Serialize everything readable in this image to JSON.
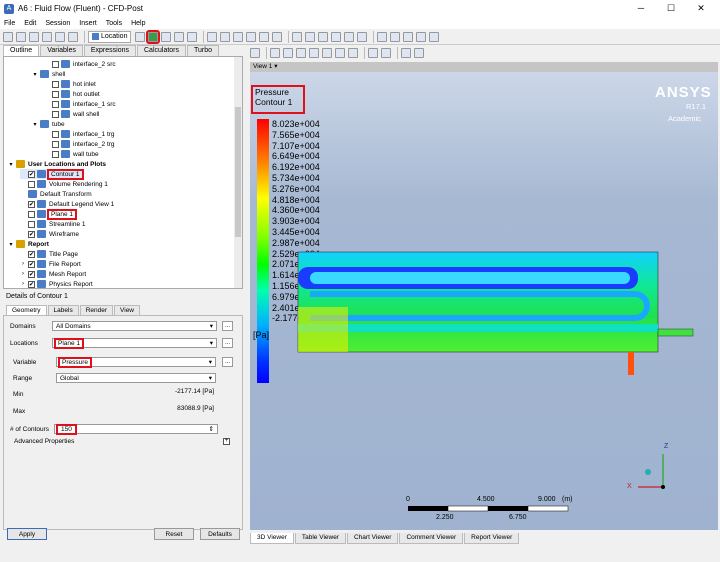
{
  "window": {
    "title": "A6 : Fluid Flow (Fluent) - CFD-Post",
    "minimize": "─",
    "maximize": "☐",
    "close": "✕"
  },
  "menu": [
    "File",
    "Edit",
    "Session",
    "Insert",
    "Tools",
    "Help"
  ],
  "toolbar": {
    "location_label": "Location"
  },
  "left_tabs": [
    "Outline",
    "Variables",
    "Expressions",
    "Calculators",
    "Turbo"
  ],
  "tree": [
    {
      "label": "interface_2 src",
      "indent": 3,
      "cb": "",
      "icon": "b",
      "tw": ""
    },
    {
      "label": "shell",
      "indent": 2,
      "cb": null,
      "icon": "b",
      "tw": "▾"
    },
    {
      "label": "hot inlet",
      "indent": 3,
      "cb": "",
      "icon": "b",
      "tw": ""
    },
    {
      "label": "hot outlet",
      "indent": 3,
      "cb": "",
      "icon": "b",
      "tw": ""
    },
    {
      "label": "interface_1 src",
      "indent": 3,
      "cb": "",
      "icon": "b",
      "tw": ""
    },
    {
      "label": "wall shell",
      "indent": 3,
      "cb": "",
      "icon": "b",
      "tw": ""
    },
    {
      "label": "tube",
      "indent": 2,
      "cb": null,
      "icon": "b",
      "tw": "▾"
    },
    {
      "label": "interface_1 trg",
      "indent": 3,
      "cb": "",
      "icon": "b",
      "tw": ""
    },
    {
      "label": "interface_2 trg",
      "indent": 3,
      "cb": "",
      "icon": "b",
      "tw": ""
    },
    {
      "label": "wall tube",
      "indent": 3,
      "cb": "",
      "icon": "b",
      "tw": ""
    },
    {
      "label": "User Locations and Plots",
      "indent": 0,
      "cb": null,
      "icon": "y",
      "tw": "▾",
      "bold": true
    },
    {
      "label": "Contour 1",
      "indent": 1,
      "cb": "✔",
      "icon": "b",
      "tw": "",
      "red": true,
      "sel": true
    },
    {
      "label": "Volume Rendering 1",
      "indent": 1,
      "cb": "",
      "icon": "b",
      "tw": ""
    },
    {
      "label": "Default Transform",
      "indent": 1,
      "cb": null,
      "icon": "b",
      "tw": ""
    },
    {
      "label": "Default Legend View 1",
      "indent": 1,
      "cb": "✔",
      "icon": "b",
      "tw": ""
    },
    {
      "label": "Plane 1",
      "indent": 1,
      "cb": "",
      "icon": "b",
      "tw": "",
      "red": true
    },
    {
      "label": "Streamline 1",
      "indent": 1,
      "cb": "",
      "icon": "b",
      "tw": ""
    },
    {
      "label": "Wireframe",
      "indent": 1,
      "cb": "✔",
      "icon": "b",
      "tw": ""
    },
    {
      "label": "Report",
      "indent": 0,
      "cb": null,
      "icon": "y",
      "tw": "▾",
      "bold": true
    },
    {
      "label": "Title Page",
      "indent": 1,
      "cb": "✔",
      "icon": "b",
      "tw": ""
    },
    {
      "label": "File Report",
      "indent": 1,
      "cb": "✔",
      "icon": "b",
      "tw": "›"
    },
    {
      "label": "Mesh Report",
      "indent": 1,
      "cb": "✔",
      "icon": "b",
      "tw": "›"
    },
    {
      "label": "Physics Report",
      "indent": 1,
      "cb": "✔",
      "icon": "b",
      "tw": "›"
    }
  ],
  "details": {
    "title": "Details of Contour 1",
    "tabs": [
      "Geometry",
      "Labels",
      "Render",
      "View"
    ],
    "domains_label": "Domains",
    "domains_value": "All Domains",
    "locations_label": "Locations",
    "locations_value": "Plane 1",
    "variable_label": "Variable",
    "variable_value": "Pressure",
    "range_label": "Range",
    "range_value": "Global",
    "min_label": "Min",
    "min_value": "-2177.14 [Pa]",
    "max_label": "Max",
    "max_value": "83088.9 [Pa]",
    "contours_label": "# of Contours",
    "contours_value": "150",
    "advanced_label": "Advanced Properties",
    "ellipsis": "...",
    "apply": "Apply",
    "reset": "Reset",
    "defaults": "Defaults"
  },
  "view": {
    "label": "View 1",
    "legend_title": "Pressure",
    "legend_sub": "Contour 1",
    "ticks": [
      "8.023e+004",
      "7.565e+004",
      "7.107e+004",
      "6.649e+004",
      "6.192e+004",
      "5.734e+004",
      "5.276e+004",
      "4.818e+004",
      "4.360e+004",
      "3.903e+004",
      "3.445e+004",
      "2.987e+004",
      "2.529e+004",
      "2.071e+004",
      "1.614e+004",
      "1.156e+004",
      "6.979e+003",
      "2.401e+003",
      "-2.177e+003"
    ],
    "unit": "[Pa]",
    "brand": "ANSYS",
    "release": "R17.1",
    "edition": "Academic",
    "scale_top": [
      "0",
      "4.500",
      "9.000",
      "(m)"
    ],
    "scale_bottom": [
      "2.250",
      "6.750"
    ],
    "axis_z": "Z",
    "axis_x": "X"
  },
  "bottom_tabs": [
    "3D Viewer",
    "Table Viewer",
    "Chart Viewer",
    "Comment Viewer",
    "Report Viewer"
  ]
}
